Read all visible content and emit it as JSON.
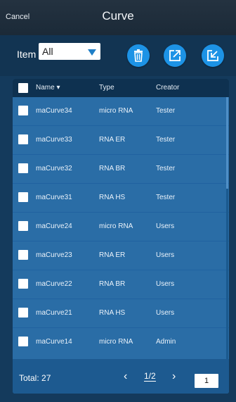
{
  "header": {
    "cancel_label": "Cancel",
    "title": "Curve"
  },
  "filter": {
    "item_label": "Item",
    "selected": "All"
  },
  "toolbar": {
    "icons": [
      "trash-icon",
      "export-icon",
      "import-icon"
    ]
  },
  "table": {
    "columns": {
      "name": "Name ▾",
      "type": "Type",
      "creator": "Creator"
    },
    "rows": [
      {
        "name": "maCurve34",
        "type": "micro RNA",
        "creator": "Tester"
      },
      {
        "name": "maCurve33",
        "type": "RNA ER",
        "creator": "Tester"
      },
      {
        "name": "maCurve32",
        "type": "RNA BR",
        "creator": "Tester"
      },
      {
        "name": "maCurve31",
        "type": "RNA HS",
        "creator": "Tester"
      },
      {
        "name": "maCurve24",
        "type": "micro RNA",
        "creator": "Users"
      },
      {
        "name": "maCurve23",
        "type": "RNA ER",
        "creator": "Users"
      },
      {
        "name": "maCurve22",
        "type": "RNA BR",
        "creator": "Users"
      },
      {
        "name": "maCurve21",
        "type": "RNA HS",
        "creator": "Users"
      },
      {
        "name": "maCurve14",
        "type": "micro RNA",
        "creator": "Admin"
      }
    ]
  },
  "footer": {
    "total": "Total: 27",
    "prev": "‹",
    "page": "1/2",
    "next": "›",
    "page_input": "1"
  },
  "colors": {
    "accent": "#1d93e6",
    "table_bg": "#2a6da6",
    "header_bg": "#0e3150"
  }
}
